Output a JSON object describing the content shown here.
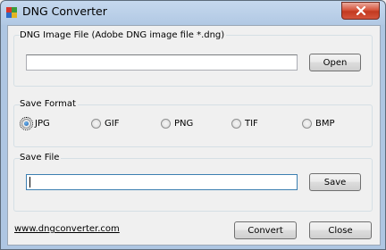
{
  "window": {
    "title": "DNG Converter",
    "icon": "dng-app-icon",
    "close_icon": "close-icon"
  },
  "input_group": {
    "label": "DNG Image File (Adobe DNG image file *.dng)",
    "path_value": "",
    "open_button": "Open"
  },
  "format_group": {
    "label": "Save Format",
    "options": [
      "JPG",
      "GIF",
      "PNG",
      "TIF",
      "BMP"
    ],
    "selected": "JPG"
  },
  "save_group": {
    "label": "Save File",
    "path_value": "",
    "save_button": "Save"
  },
  "footer": {
    "website_link": "www.dngconverter.com",
    "convert_button": "Convert",
    "close_button": "Close"
  },
  "colors": {
    "title_gradient_top": "#c5d8ee",
    "close_button_red": "#c23a20",
    "radio_selected_blue": "#1b5fa8"
  }
}
